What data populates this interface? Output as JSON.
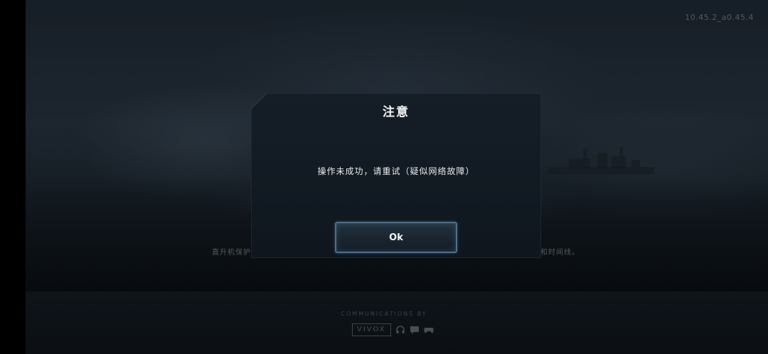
{
  "version_text": "10.45.2_a0.45.4",
  "dialog": {
    "title": "注意",
    "message": "操作未成功，请重试（疑似网络故障）",
    "ok_label": "Ok"
  },
  "background": {
    "left_hint": "直升机保护",
    "right_hint": "和时间线。",
    "comm_label": "COMMUNICATIONS BY",
    "vivox_label": "VIVOX",
    "vivox_icons": [
      "headset-icon",
      "chat-icon",
      "gamepad-icon"
    ]
  },
  "colors": {
    "dialog_bg": "#111922",
    "button_border": "#4c6f8a",
    "text": "#f2f4f6"
  }
}
